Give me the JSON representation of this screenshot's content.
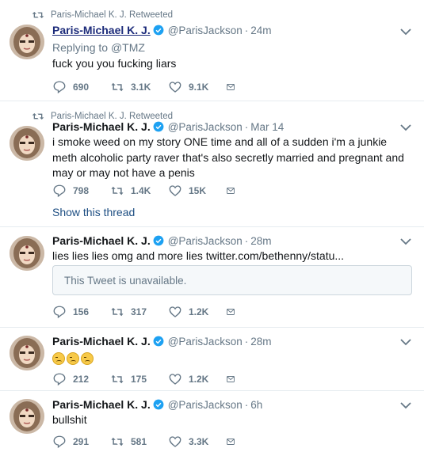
{
  "colors": {
    "text": "#14171a",
    "muted": "#657786",
    "link": "#1d4e82",
    "verified": "#1da1f2",
    "divider": "#e6ecf0"
  },
  "tweets": [
    {
      "retweet_context": "Paris-Michael K. J. Retweeted",
      "name": "Paris-Michael K. J.",
      "handle": "@ParisJackson",
      "time": "24m",
      "replying_to_label": "Replying to",
      "replying_to_handle": "@TMZ",
      "text": "fuck you you fucking liars",
      "replies": "690",
      "retweets": "3.1K",
      "likes": "9.1K"
    },
    {
      "retweet_context": "Paris-Michael K. J. Retweeted",
      "name": "Paris-Michael K. J.",
      "handle": "@ParisJackson",
      "time": "Mar 14",
      "text": "i smoke weed on my story ONE time and all of a sudden i'm a junkie meth alcoholic party raver that's also secretly married and pregnant and may or may not have a penis",
      "replies": "798",
      "retweets": "1.4K",
      "likes": "15K",
      "show_thread": "Show this thread"
    },
    {
      "name": "Paris-Michael K. J.",
      "handle": "@ParisJackson",
      "time": "28m",
      "text": "lies lies lies omg and more lies twitter.com/bethenny/statu...",
      "quote_unavailable": "This Tweet is unavailable.",
      "replies": "156",
      "retweets": "317",
      "likes": "1.2K"
    },
    {
      "name": "Paris-Michael K. J.",
      "handle": "@ParisJackson",
      "time": "28m",
      "emoji_count": 3,
      "emoji_name": "rolling-eyes-emoji",
      "replies": "212",
      "retweets": "175",
      "likes": "1.2K"
    },
    {
      "name": "Paris-Michael K. J.",
      "handle": "@ParisJackson",
      "time": "6h",
      "text": "bullshit",
      "replies": "291",
      "retweets": "581",
      "likes": "3.3K"
    }
  ],
  "icons": {
    "retweet_context": "retweet-icon",
    "verified": "verified-badge-icon",
    "caret": "chevron-down-icon",
    "reply": "reply-icon",
    "retweet": "retweet-icon",
    "like": "heart-icon",
    "dm": "envelope-icon"
  }
}
